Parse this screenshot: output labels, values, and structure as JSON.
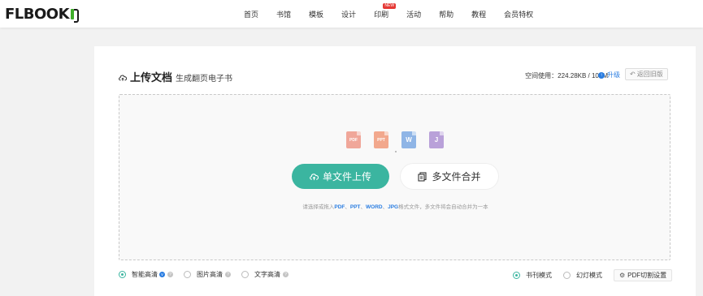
{
  "header": {
    "logo_text": "FLBOOK",
    "nav": [
      {
        "label": "首页"
      },
      {
        "label": "书馆"
      },
      {
        "label": "模板"
      },
      {
        "label": "设计"
      },
      {
        "label": "印刷",
        "badge": "NEW"
      },
      {
        "label": "活动"
      },
      {
        "label": "帮助"
      },
      {
        "label": "教程"
      },
      {
        "label": "会员特权"
      }
    ]
  },
  "upload": {
    "title": "上传文档",
    "subtitle": "生成翻页电子书",
    "usage_label": "空间使用：224.28KB / 100M",
    "upgrade_label": "升级",
    "back_label": "返回旧版",
    "file_types": [
      "PDF",
      "PPT",
      "W",
      "J"
    ],
    "single_button": "单文件上传",
    "merge_button": "多文件合并",
    "hint_prefix": "请选择或拖入",
    "hint_types": [
      "PDF",
      "PPT",
      "WORD",
      "JPG"
    ],
    "hint_suffix": "格式文件，多文件将会自动合并为一本"
  },
  "options": {
    "quality": [
      {
        "label": "智能高清",
        "selected": true
      },
      {
        "label": "图片高清",
        "selected": false
      },
      {
        "label": "文字高清",
        "selected": false
      }
    ],
    "mode": [
      {
        "label": "书刊模式",
        "selected": true
      },
      {
        "label": "幻灯模式",
        "selected": false
      }
    ],
    "pdf_button": "PDF切割设置"
  },
  "colors": {
    "accent": "#3bb5a0",
    "link": "#2a7de1",
    "badge": "#e53935"
  }
}
